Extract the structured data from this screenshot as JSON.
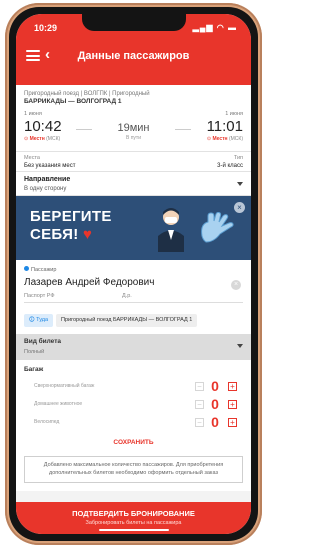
{
  "status": {
    "time": "10:29",
    "signal": "▂▄▆ ◠ ▬"
  },
  "header": {
    "title": "Данные пассажиров"
  },
  "trip": {
    "type": "Пригородный поезд | ВОЛГПК | Пригородный",
    "route": "БАРРИКАДЫ — ВОЛГОГРАД 1",
    "departure": {
      "date": "1 июня",
      "time": "10:42",
      "place": "Местн",
      "tz": "(МСК)"
    },
    "duration": {
      "value": "19мин",
      "sub": "В пути"
    },
    "arrival": {
      "date": "1 июня",
      "time": "11:01",
      "place": "Местн",
      "tz": "(МСК)"
    }
  },
  "seats": {
    "label_left": "Места",
    "value_left": "Без указания мест",
    "label_right": "Тип",
    "value_right": "3-й класс"
  },
  "direction": {
    "label": "Направление",
    "value": "В одну сторону"
  },
  "banner": {
    "line1": "БЕРЕГИТЕ",
    "line2": "СЕБЯ!",
    "heart": "♥",
    "close": "×"
  },
  "passenger": {
    "tag": "Пассажир",
    "name": "Лазарев Андрей Федорович",
    "doc": "Паспорт РФ",
    "dob": "Д.р.",
    "remove": "×",
    "chip1": "Туда",
    "chip2": "Пригородный поезд БАРРИКАДЫ — ВОЛГОГРАД 1"
  },
  "ticket": {
    "label": "Вид билета",
    "value": "Полный"
  },
  "baggage": {
    "title": "Багаж",
    "items": [
      {
        "label": "Сверхнормативный багаж",
        "count": "0"
      },
      {
        "label": "Домашнее животное",
        "count": "0"
      },
      {
        "label": "Велосипед",
        "count": "0"
      }
    ],
    "minus": "−",
    "plus": "+"
  },
  "save_label": "СОХРАНИТЬ",
  "note": "Добавлено максимальное количество пассажиров. Для приобретения дополнительных билетов необходимо оформить отдельный заказ",
  "confirm": {
    "label": "ПОДТВЕРДИТЬ БРОНИРОВАНИЕ",
    "sub": "Забронировать билеты на пассажира"
  },
  "colors": {
    "accent": "#e8352b",
    "banner": "#2d4f78",
    "chip_blue": "#1e88e5"
  },
  "icons": {
    "menu": "menu-icon",
    "back": "back-arrow-icon",
    "close": "close-icon",
    "dropdown": "chevron-down-icon"
  }
}
